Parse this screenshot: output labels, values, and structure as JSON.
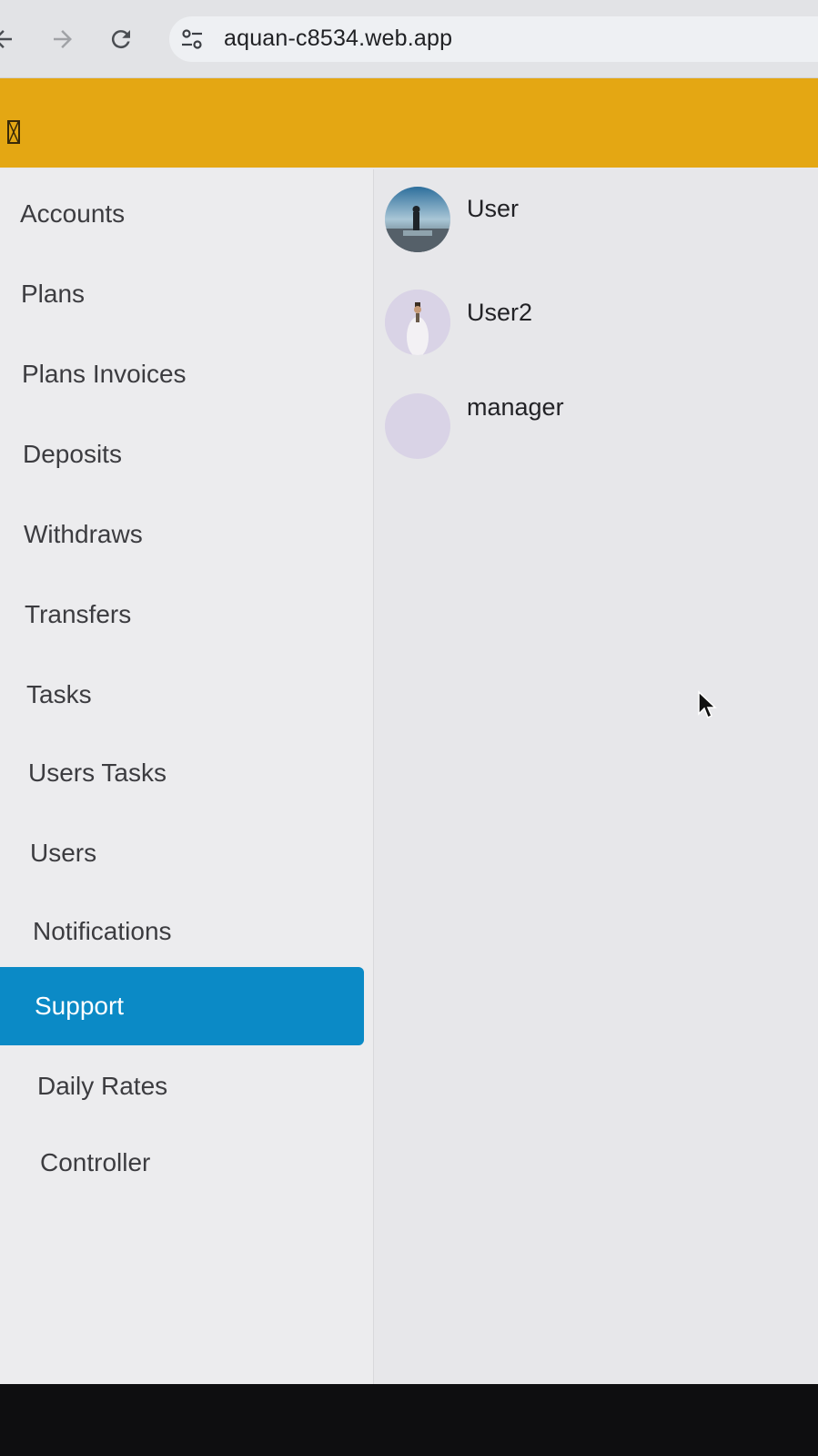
{
  "browser": {
    "url": "aquan-c8534.web.app",
    "back_icon": "arrow-left-icon",
    "forward_icon": "arrow-right-icon",
    "reload_icon": "reload-icon",
    "site_info_icon": "tune-icon"
  },
  "app_bar": {
    "color": "#e4a713",
    "menu_icon": "menu-icon"
  },
  "sidebar": {
    "items": [
      {
        "label": "Accounts",
        "active": false
      },
      {
        "label": "Plans",
        "active": false
      },
      {
        "label": "Plans Invoices",
        "active": false
      },
      {
        "label": "Deposits",
        "active": false
      },
      {
        "label": "Withdraws",
        "active": false
      },
      {
        "label": "Transfers",
        "active": false
      },
      {
        "label": "Tasks",
        "active": false
      },
      {
        "label": "Users Tasks",
        "active": false
      },
      {
        "label": "Users",
        "active": false
      },
      {
        "label": "Notifications",
        "active": false
      },
      {
        "label": "Support",
        "active": true
      },
      {
        "label": "Daily Rates",
        "active": false
      },
      {
        "label": "Controller",
        "active": false
      }
    ],
    "active_color": "#0b8ac6"
  },
  "users": [
    {
      "name": "User",
      "avatar": "photo-avatar"
    },
    {
      "name": "User2",
      "avatar": "photo-avatar"
    },
    {
      "name": "manager",
      "avatar": "placeholder-avatar"
    }
  ]
}
